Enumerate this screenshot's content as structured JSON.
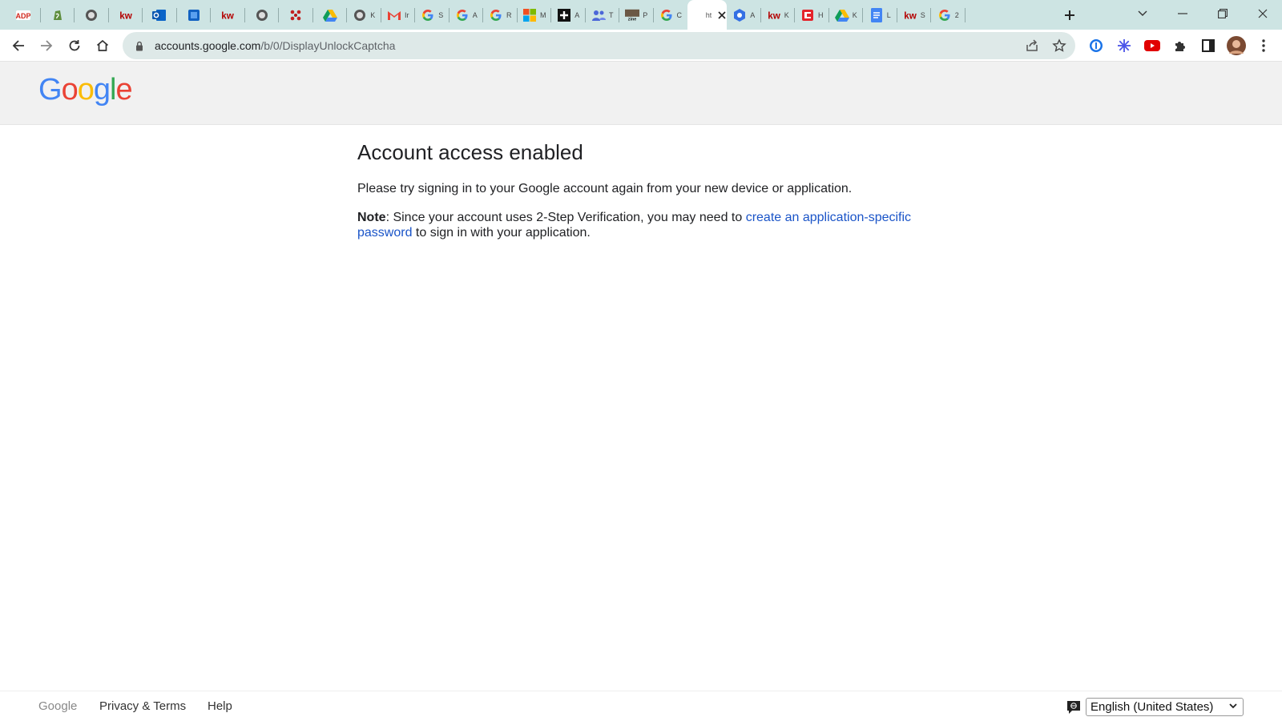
{
  "browser": {
    "tabs": [
      {
        "icon": "adp-icon",
        "label": ""
      },
      {
        "icon": "shopify-icon",
        "label": ""
      },
      {
        "icon": "globe-icon",
        "label": ""
      },
      {
        "icon": "kw-icon",
        "label": "kw"
      },
      {
        "icon": "outlook-icon",
        "label": ""
      },
      {
        "icon": "azure-icon",
        "label": ""
      },
      {
        "icon": "kw-icon",
        "label": "kw"
      },
      {
        "icon": "globe-icon",
        "label": ""
      },
      {
        "icon": "flower-icon",
        "label": ""
      },
      {
        "icon": "drive-icon",
        "label": ""
      },
      {
        "icon": "globe-icon",
        "label": "K"
      },
      {
        "icon": "gmail-icon",
        "label": "Ir"
      },
      {
        "icon": "google-icon",
        "label": "S"
      },
      {
        "icon": "google-icon",
        "label": "A"
      },
      {
        "icon": "google-icon",
        "label": "R"
      },
      {
        "icon": "microsoft-icon",
        "label": "M"
      },
      {
        "icon": "plus-box-icon",
        "label": "A"
      },
      {
        "icon": "teams-icon",
        "label": "T"
      },
      {
        "icon": "zine-icon",
        "label": "P"
      },
      {
        "icon": "google-icon",
        "label": "C"
      },
      {
        "icon": "blank-icon",
        "label": "ht"
      },
      {
        "icon": "chrome-web-icon",
        "label": "A"
      },
      {
        "icon": "kw-icon",
        "label": "K"
      },
      {
        "icon": "c-icon",
        "label": "H"
      },
      {
        "icon": "drive-icon",
        "label": "K"
      },
      {
        "icon": "docs-icon",
        "label": "L"
      },
      {
        "icon": "kw-icon",
        "label": "S"
      },
      {
        "icon": "google-icon",
        "label": "2"
      }
    ],
    "active_tab_index": 20,
    "url_host": "accounts.google.com",
    "url_path": "/b/0/DisplayUnlockCaptcha"
  },
  "header": {
    "logo_letters": [
      "G",
      "o",
      "o",
      "g",
      "l",
      "e"
    ],
    "logo_colors": [
      "#4285F4",
      "#EA4335",
      "#FBBC05",
      "#4285F4",
      "#34A853",
      "#EA4335"
    ]
  },
  "main": {
    "title": "Account access enabled",
    "message": "Please try signing in to your Google account again from your new device or application.",
    "note_label": "Note",
    "note_text_before": ": Since your account uses 2-Step Verification, you may need to ",
    "note_link": "create an application-specific password",
    "note_text_after": " to sign in with your application."
  },
  "footer": {
    "brand": "Google",
    "privacy_terms": "Privacy & Terms",
    "help": "Help",
    "language": "English (United States)"
  },
  "colors": {
    "link": "#1a54c8",
    "tabstrip": "#cde4e3"
  }
}
